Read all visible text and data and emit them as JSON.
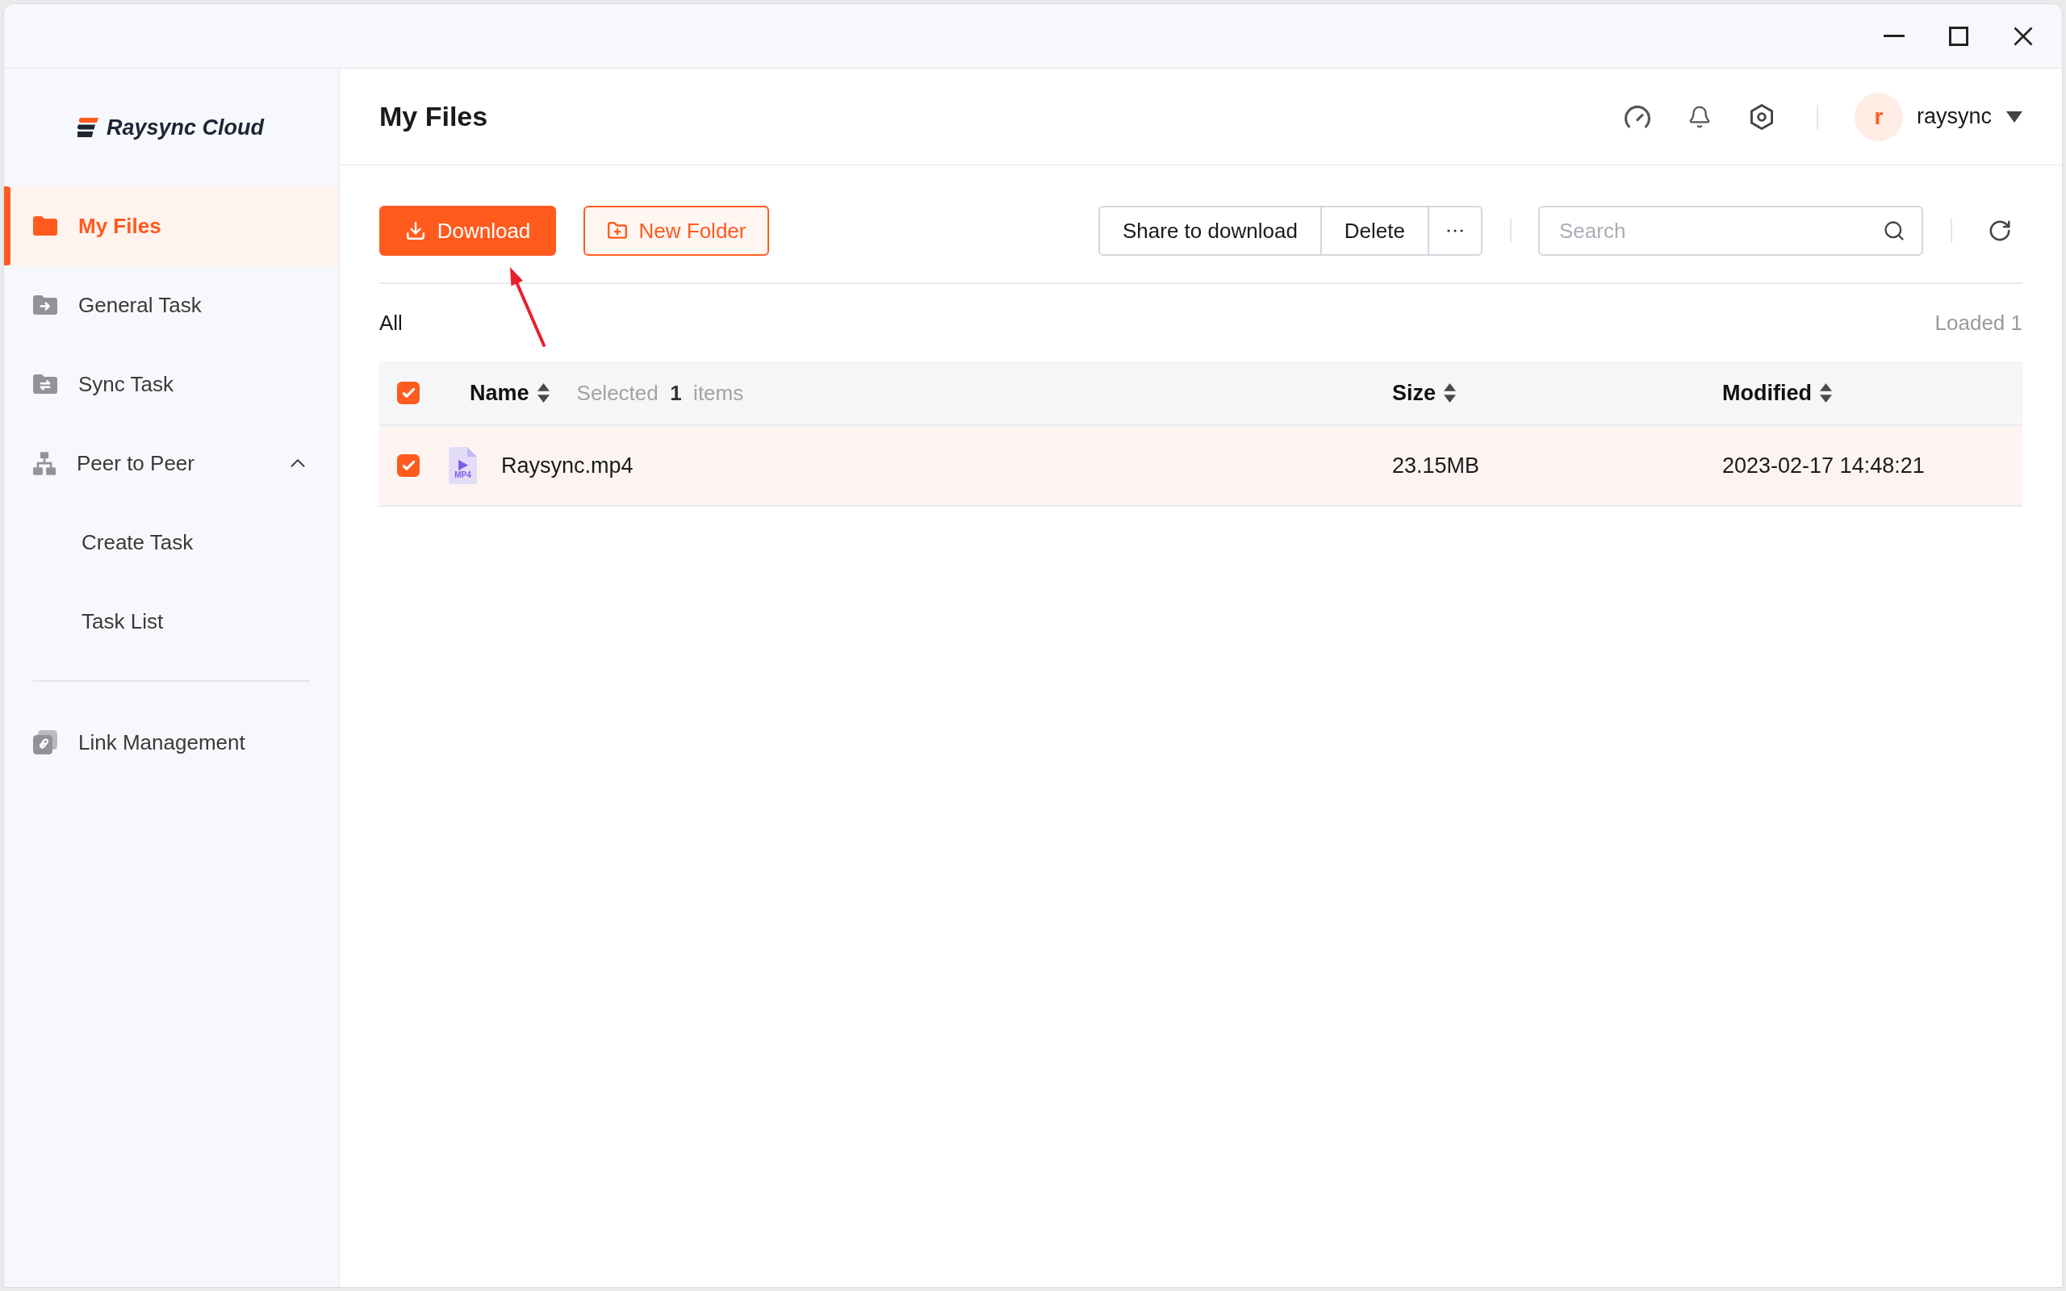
{
  "sidebar": {
    "logo": "Raysync Cloud",
    "sections": [
      {
        "items": [
          {
            "label": "My Files",
            "selected": true
          },
          {
            "label": "General Task",
            "selected": false
          },
          {
            "label": "Sync Task",
            "selected": false
          },
          {
            "label": "Peer to Peer",
            "selected": false,
            "expanded": true,
            "children": [
              {
                "label": "Create Task",
                "selected": false
              },
              {
                "label": "Task List",
                "selected": false
              }
            ]
          }
        ]
      },
      {
        "items": [
          {
            "label": "Link Management",
            "selected": false
          }
        ]
      }
    ]
  },
  "header": {
    "title": "My Files",
    "user": {
      "initial": "r",
      "name": "raysync"
    }
  },
  "toolbar": {
    "primary_button": "Download",
    "secondary_button": "New Folder",
    "button_group": [
      "Share to download",
      "Delete"
    ],
    "search": {
      "placeholder": "Search"
    }
  },
  "list_bar": {
    "path": "All",
    "count": "Loaded 1"
  },
  "table": {
    "header_checked": true,
    "selection_note": "Selected  **1**  items",
    "columns": [
      {
        "label": "Name",
        "sortable": true
      },
      {
        "label": "Size",
        "sortable": true
      },
      {
        "label": "Modified",
        "sortable": true
      }
    ],
    "rows": [
      {
        "checked": true,
        "file_type": "MP4",
        "name": "Raysync.mp4",
        "size": "23.15MB",
        "modified": "2023-02-17 14:48:21"
      }
    ]
  }
}
